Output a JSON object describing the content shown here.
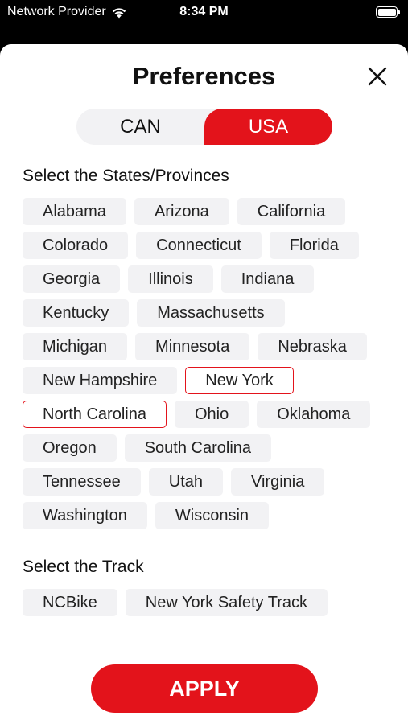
{
  "status_bar": {
    "carrier": "Network Provider",
    "time": "8:34 PM"
  },
  "sheet": {
    "title": "Preferences"
  },
  "country_toggle": {
    "options": [
      "CAN",
      "USA"
    ],
    "selected": "USA"
  },
  "states_section": {
    "heading": "Select the States/Provinces",
    "items": [
      {
        "label": "Alabama",
        "selected": false
      },
      {
        "label": "Arizona",
        "selected": false
      },
      {
        "label": "California",
        "selected": false
      },
      {
        "label": "Colorado",
        "selected": false
      },
      {
        "label": "Connecticut",
        "selected": false
      },
      {
        "label": "Florida",
        "selected": false
      },
      {
        "label": "Georgia",
        "selected": false
      },
      {
        "label": "Illinois",
        "selected": false
      },
      {
        "label": "Indiana",
        "selected": false
      },
      {
        "label": "Kentucky",
        "selected": false
      },
      {
        "label": "Massachusetts",
        "selected": false
      },
      {
        "label": "Michigan",
        "selected": false
      },
      {
        "label": "Minnesota",
        "selected": false
      },
      {
        "label": "Nebraska",
        "selected": false
      },
      {
        "label": "New Hampshire",
        "selected": false
      },
      {
        "label": "New York",
        "selected": true
      },
      {
        "label": "North Carolina",
        "selected": true
      },
      {
        "label": "Ohio",
        "selected": false
      },
      {
        "label": "Oklahoma",
        "selected": false
      },
      {
        "label": "Oregon",
        "selected": false
      },
      {
        "label": "South Carolina",
        "selected": false
      },
      {
        "label": "Tennessee",
        "selected": false
      },
      {
        "label": "Utah",
        "selected": false
      },
      {
        "label": "Virginia",
        "selected": false
      },
      {
        "label": "Washington",
        "selected": false
      },
      {
        "label": "Wisconsin",
        "selected": false
      }
    ]
  },
  "track_section": {
    "heading": "Select the Track",
    "items": [
      {
        "label": "NCBike",
        "selected": false
      },
      {
        "label": "New York Safety Track",
        "selected": false
      }
    ]
  },
  "apply_label": "APPLY",
  "colors": {
    "accent": "#e3131b",
    "chip_background": "#f2f2f4"
  },
  "icons": {
    "close": "close-icon",
    "wifi": "wifi-icon",
    "battery": "battery-icon"
  }
}
